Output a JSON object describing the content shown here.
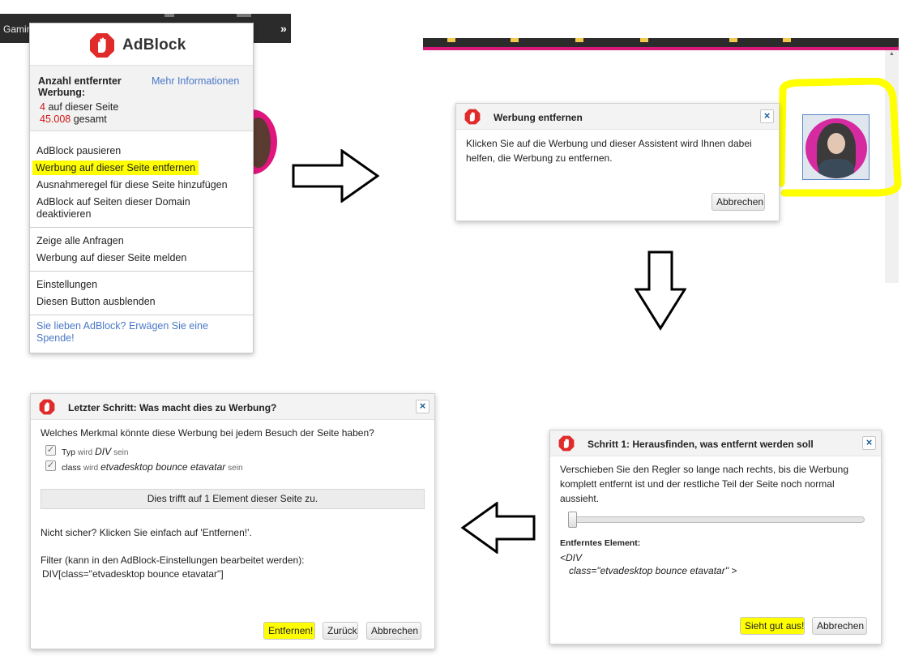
{
  "browser": {
    "tab_label": "Gamin",
    "overflow_chevron": "»"
  },
  "adblock_popup": {
    "brand": "AdBlock",
    "stats": {
      "title": "Anzahl entfernter Werbung:",
      "more_info": "Mehr Informationen",
      "on_page_count": "4",
      "on_page_label": "auf dieser Seite",
      "total_count": "45.008",
      "total_label": "gesamt"
    },
    "menu": {
      "pause": "AdBlock pausieren",
      "remove_ad": "Werbung auf dieser Seite entfernen",
      "add_exception": "Ausnahmeregel für diese Seite hinzufügen",
      "disable_domain": "AdBlock auf Seiten dieser Domain deaktivieren",
      "show_requests": "Zeige alle Anfragen",
      "report_ad": "Werbung auf dieser Seite melden",
      "settings": "Einstellungen",
      "hide_button": "Diesen Button ausblenden",
      "donate": "Sie lieben AdBlock? Erwägen Sie eine Spende!"
    },
    "highlight_color": "#ffff00"
  },
  "dialog_remove": {
    "title": "Werbung entfernen",
    "close": "×",
    "text": "Klicken Sie auf die Werbung und dieser Assistent wird Ihnen dabei helfen, die Werbung zu entfernen.",
    "cancel": "Abbrechen"
  },
  "dialog_step1": {
    "title": "Schritt 1: Herausfinden, was entfernt werden soll",
    "close": "×",
    "text": "Verschieben Sie den Regler so lange nach rechts, bis die Werbung komplett entfernt ist und der restliche Teil der Seite noch normal aussieht.",
    "slider_value": 0,
    "removed_label": "Entferntes Element:",
    "element_line1": "<DIV",
    "element_line2": "class=\"etvadesktop bounce etavatar\" >",
    "looks_good": "Sieht gut aus!",
    "cancel": "Abbrechen"
  },
  "dialog_last": {
    "title": "Letzter Schritt: Was macht dies zu Werbung?",
    "close": "×",
    "question": "Welches Merkmal könnte diese Werbung bei jedem Besuch der Seite haben?",
    "criteria": [
      {
        "key": "Typ",
        "verb": "wird",
        "value": "DIV",
        "suffix": "sein",
        "checked": true
      },
      {
        "key": "class",
        "verb": "wird",
        "value": "etvadesktop bounce etavatar",
        "suffix": "sein",
        "checked": true
      }
    ],
    "match": "Dies trifft auf 1 Element dieser Seite zu.",
    "unsure": "Nicht sicher? Klicken Sie einfach auf 'Entfernen!'.",
    "filter_label": "Filter (kann in den AdBlock-Einstellungen bearbeitet werden):",
    "filter_value": "DIV[class=\"etvadesktop bounce etavatar\"]",
    "remove": "Entfernen!",
    "back": "Zurück",
    "cancel": "Abbrechen"
  },
  "colors": {
    "accent_link": "#4a78c8",
    "brand_red": "#d01515",
    "page_pink": "#d91a7a",
    "annotation_yellow": "#ffff00"
  }
}
